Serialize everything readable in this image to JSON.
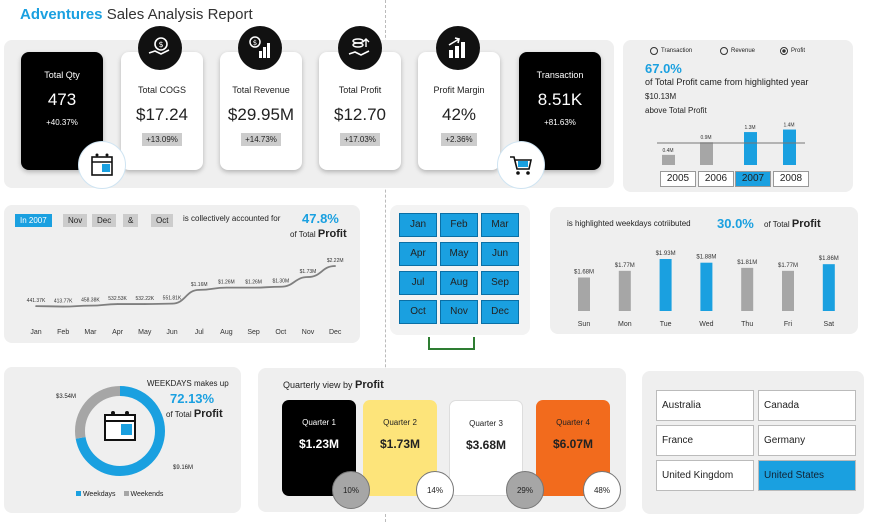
{
  "title": {
    "bold": "Adventures",
    "rest": "Sales Analysis Report"
  },
  "kpis": [
    {
      "label": "Total Qty",
      "value": "473",
      "change": "+40.37%",
      "dark": true
    },
    {
      "label": "Total COGS",
      "value": "$17.24",
      "change": "+13.09%",
      "icon": "money-bag-hand-icon"
    },
    {
      "label": "Total Revenue",
      "value": "$29.95M",
      "change": "+14.73%",
      "icon": "dollar-bar-chart-icon"
    },
    {
      "label": "Total Profit",
      "value": "$12.70",
      "change": "+17.03%",
      "icon": "coins-hand-icon"
    },
    {
      "label": "Profit Margin",
      "value": "42%",
      "change": "+2.36%",
      "icon": "growth-bars-icon"
    },
    {
      "label": "Transaction",
      "value": "8.51K",
      "change": "+81.63%",
      "dark": true
    }
  ],
  "year_panel": {
    "radios": [
      "Transaction",
      "Revenue",
      "Profit"
    ],
    "selected_radio": "Profit",
    "pct": "67.0%",
    "line1": "of Total Profit came from highlighted year",
    "amount": "$10.13M",
    "line2": "above Total Profit",
    "years": [
      "2005",
      "2006",
      "2007",
      "2008"
    ],
    "selected_year": "2007"
  },
  "monthly_panel": {
    "tags": [
      "In 2007",
      "Nov",
      "Dec",
      "&",
      "Oct"
    ],
    "text": "is collectively accounted for",
    "pct": "47.8%",
    "of_total": "of Total",
    "profit": "Profit"
  },
  "months": [
    "Jan",
    "Feb",
    "Mar",
    "Apr",
    "May",
    "Jun",
    "Jul",
    "Aug",
    "Sep",
    "Oct",
    "Nov",
    "Dec"
  ],
  "weekday_panel": {
    "text": "is highlighted weekdays cotriibuted",
    "pct": "30.0%",
    "of_total": "of Total",
    "profit": "Profit"
  },
  "donut_panel": {
    "heading": "WEEKDAYS makes up",
    "pct": "72.13%",
    "of_total": "of Total",
    "profit": "Profit",
    "label_weekend": "$3.54M",
    "label_weekday": "$9.16M",
    "legend": [
      "Weekdays",
      "Weekends"
    ]
  },
  "quarter_panel": {
    "heading": "Quarterly view by",
    "profit": "Profit",
    "quarters": [
      {
        "label": "Quarter 1",
        "value": "$1.23M",
        "pct": "10%"
      },
      {
        "label": "Quarter 2",
        "value": "$1.73M",
        "pct": "14%"
      },
      {
        "label": "Quarter 3",
        "value": "$3.68M",
        "pct": "29%"
      },
      {
        "label": "Quarter 4",
        "value": "$6.07M",
        "pct": "48%"
      }
    ]
  },
  "countries": [
    "Australia",
    "Canada",
    "France",
    "Germany",
    "United Kingdom",
    "United States"
  ],
  "selected_country": "United States",
  "colors": {
    "accent": "#1aa0e0",
    "grey": "#a6a6a6",
    "q1": "#000000",
    "q2": "#fde47a",
    "q3": "#ffffff",
    "q4": "#f26b1d"
  },
  "chart_data": [
    {
      "type": "bar",
      "categories": [
        "2005",
        "2006",
        "2007",
        "2008"
      ],
      "values": [
        0.4,
        0.9,
        1.3,
        1.4
      ],
      "labels": [
        "0.4M",
        "0.9M",
        "1.3M",
        "1.4M"
      ],
      "highlighted": [
        "2007",
        "2008"
      ]
    },
    {
      "type": "line",
      "x": [
        "Jan",
        "Feb",
        "Mar",
        "Apr",
        "May",
        "Jun",
        "Jul",
        "Aug",
        "Sep",
        "Oct",
        "Nov",
        "Dec"
      ],
      "values": [
        0.44,
        0.42,
        0.46,
        0.53,
        0.53,
        0.55,
        1.16,
        1.26,
        1.26,
        1.3,
        1.73,
        2.22
      ],
      "labels": [
        "441.37K",
        "413.77K",
        "458.38K",
        "532.53K",
        "532.22K",
        "551.81K",
        "$1.16M",
        "$1.26M",
        "$1.26M",
        "$1.30M",
        "$1.73M",
        "$2.22M"
      ]
    },
    {
      "type": "bar",
      "categories": [
        "Sun",
        "Mon",
        "Tue",
        "Wed",
        "Thu",
        "Fri",
        "Sat"
      ],
      "values": [
        1.68,
        1.77,
        1.93,
        1.88,
        1.81,
        1.77,
        1.86
      ],
      "labels": [
        "$1.68M",
        "$1.77M",
        "$1.93M",
        "$1.88M",
        "$1.81M",
        "$1.77M",
        "$1.86M"
      ],
      "highlighted": [
        "Tue",
        "Wed",
        "Sat"
      ]
    },
    {
      "type": "pie",
      "categories": [
        "Weekdays",
        "Weekends"
      ],
      "values": [
        9.16,
        3.54
      ]
    }
  ]
}
